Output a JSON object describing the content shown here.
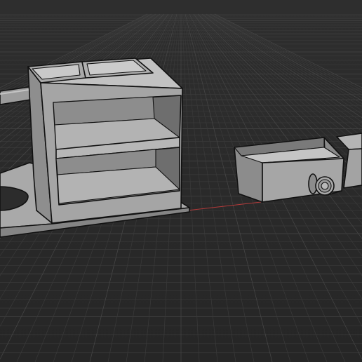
{
  "viewport": {
    "name": "3D viewport",
    "shading": "solid",
    "grid": true,
    "colors": {
      "background": "#2b2b2b",
      "grid_minor": "#3a3a3a",
      "grid_major": "#474747",
      "x_axis": "#b33a3a",
      "model_light": "#b9b9b9",
      "model_mid": "#9a9a9a",
      "model_dark": "#6f6f6f",
      "edge": "#111111"
    }
  },
  "scene": {
    "objects": [
      "shelf-unit",
      "base-plate",
      "rod",
      "top-bin-left",
      "top-bin-right",
      "drawer",
      "drawer-second",
      "knob"
    ]
  }
}
